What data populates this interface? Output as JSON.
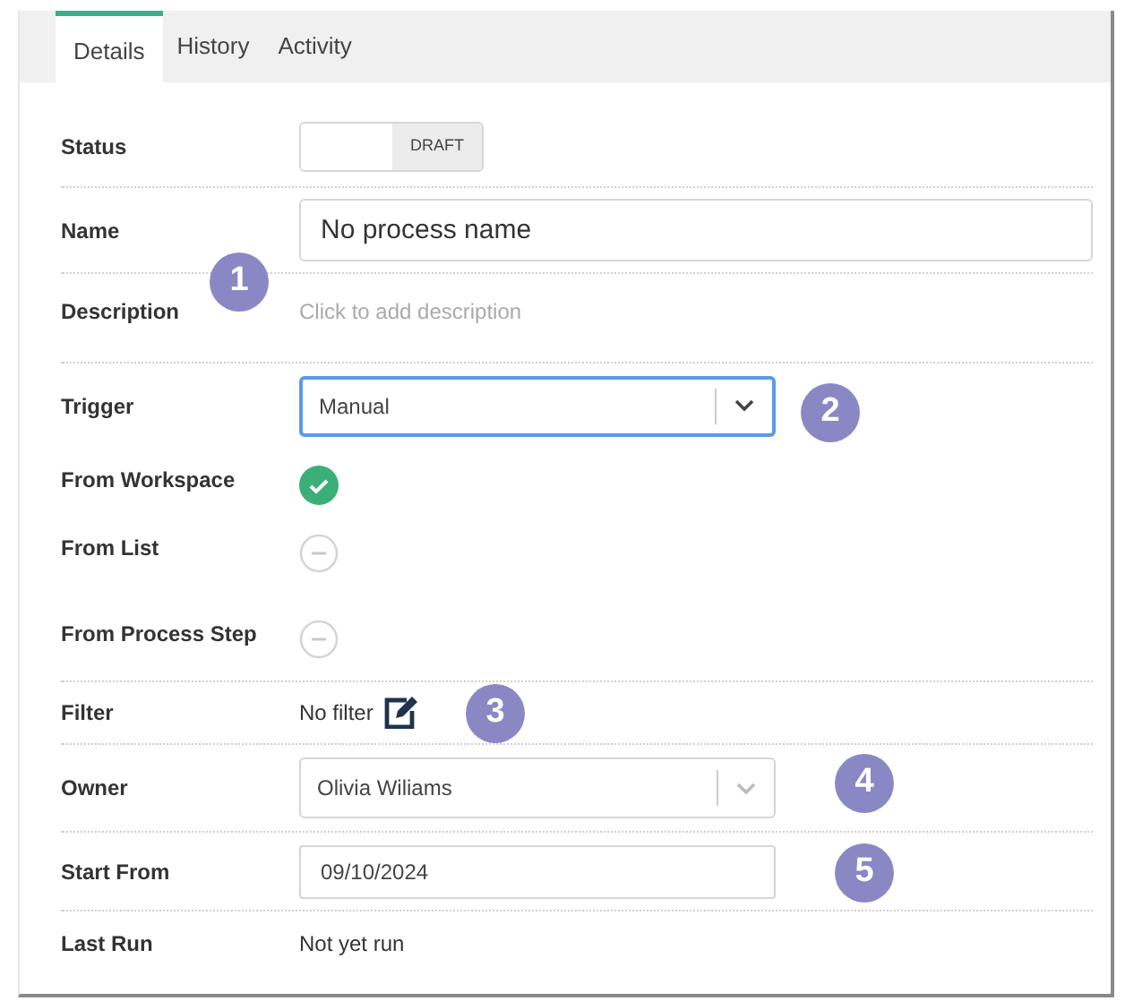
{
  "tabs": [
    {
      "label": "Details",
      "selected": true
    },
    {
      "label": "History",
      "selected": false
    },
    {
      "label": "Activity",
      "selected": false
    }
  ],
  "fields": [
    {
      "label": "Status",
      "kind": "status",
      "value": "DRAFT"
    },
    {
      "label": "Name",
      "kind": "text",
      "value": "No process name"
    },
    {
      "label": "Description",
      "kind": "hint",
      "value": "Click to add description"
    },
    {
      "label": "Trigger",
      "kind": "select",
      "value": "Manual",
      "focused": true
    },
    {
      "label": "From Workspace",
      "kind": "check",
      "checked": true
    },
    {
      "label": "From List",
      "kind": "check",
      "checked": false
    },
    {
      "label": "From Process Step",
      "kind": "check",
      "checked": false
    },
    {
      "label": "Filter",
      "kind": "filter",
      "value": "No filter"
    },
    {
      "label": "Owner",
      "kind": "select",
      "value": "Olivia Wiliams",
      "focused": false
    },
    {
      "label": "Start From",
      "kind": "date",
      "value": "09/10/2024"
    },
    {
      "label": "Last Run",
      "kind": "plain",
      "value": "Not yet run"
    }
  ],
  "callouts": [
    "1",
    "2",
    "3",
    "4",
    "5"
  ]
}
